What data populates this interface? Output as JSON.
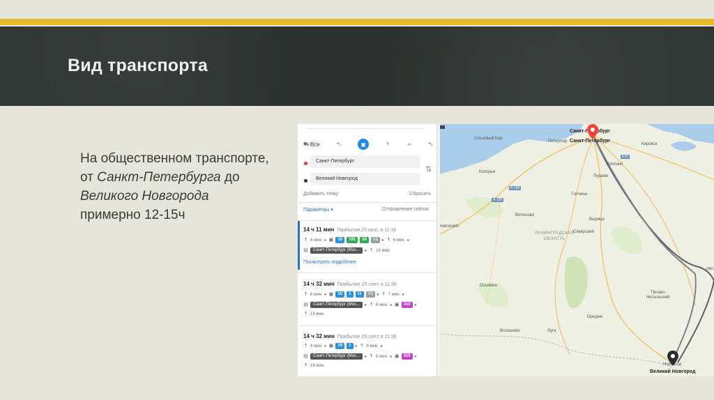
{
  "slide": {
    "title": "Вид транспорта",
    "body_line1": "На общественном транспорте,",
    "body_line2_prefix": "от ",
    "body_line2_city": "Санкт-Петербурга",
    "body_line2_suffix": " до",
    "body_line3_city": "Великого Новгорода",
    "body_line4": "примерно 12-15ч",
    "accent_color": "#e8b92c",
    "band_color": "#2f3532"
  },
  "panel": {
    "modes": [
      {
        "icon": "car-bus-icon",
        "label": "Все"
      },
      {
        "icon": "car-icon",
        "label": ""
      },
      {
        "icon": "bus-icon",
        "label": "",
        "active": true
      },
      {
        "icon": "walk-icon",
        "label": ""
      },
      {
        "icon": "bike-icon",
        "label": ""
      },
      {
        "icon": "taxi-icon",
        "label": ""
      }
    ],
    "from": "Санкт-Петербург",
    "to": "Великий Новгород",
    "add_point": "Добавить точку",
    "reset": "Сбросить",
    "params": "Параметры ▾",
    "departure": "Отправление сейчас",
    "routes": [
      {
        "duration": "14 ч 11 мин",
        "arrival": "Прибытие 25 сент, в 11:16",
        "walk1": "6 мин.",
        "badges": [
          {
            "text": "10",
            "color": "blue"
          },
          {
            "text": "191",
            "color": "green"
          },
          {
            "text": "24",
            "color": "green"
          },
          {
            "text": "+1",
            "color": "gray"
          }
        ],
        "walk2": "6 мин.",
        "train": "Санкт-Петербург (Мос...",
        "walk3": "18 мин.",
        "details": "Посмотреть подробнее"
      },
      {
        "duration": "14 ч 32 мин",
        "arrival": "Прибытие 25 сент, в 11:38",
        "walk1": "6 мин.",
        "badges": [
          {
            "text": "10",
            "color": "blue"
          },
          {
            "text": "1",
            "color": "blue"
          },
          {
            "text": "11",
            "color": "blue"
          },
          {
            "text": "+1",
            "color": "gray"
          }
        ],
        "walk2": "7 мин.",
        "train": "Санкт-Петербург (Мос...",
        "walk3": "6 мин.",
        "bus": "310",
        "walk4": "18 мин."
      },
      {
        "duration": "14 ч 32 мин",
        "arrival": "Прибытие 25 сент, в 11:38",
        "walk1": "6 мин.",
        "badges": [
          {
            "text": "10",
            "color": "blue"
          },
          {
            "text": "1",
            "color": "blue"
          }
        ],
        "walk2": "6 мин.",
        "train": "Санкт-Петербург (Мос...",
        "walk3": "6 мин.",
        "bus": "310",
        "walk4": "18 мин."
      }
    ]
  },
  "map": {
    "labels": {
      "spb1": "Санкт-Петербург",
      "spb2": "Санкт-Петербург",
      "sosnovy_bor": "Сосновый Бор",
      "petergof": "Петергоф",
      "kirovsk": "Кировск",
      "kolpino": "Колпино",
      "pushkin": "Пушкин",
      "kopore": "Копорье",
      "gatchina": "Гатчина",
      "kingisepp": "Кингисепп",
      "volosovo": "Волосово",
      "siversky": "Сиверский",
      "vyritsa": "Вырица",
      "region1": "ЛЕНИНГРАДСКАЯ",
      "region2": "ОБЛАСТЬ",
      "osmino": "Осьмино",
      "tesovo1": "Тёсово-",
      "tesovo2": "Нетыльский",
      "oredezh": "Оредеж",
      "voloshovo": "Волошово",
      "luga": "Луга",
      "novgorod_pin": "Новгород",
      "novgorod": "Великий Новгород",
      "a180_1": "А-180",
      "a180_2": "А-180",
      "e20": "Е20",
      "chudovo": "ово"
    }
  }
}
